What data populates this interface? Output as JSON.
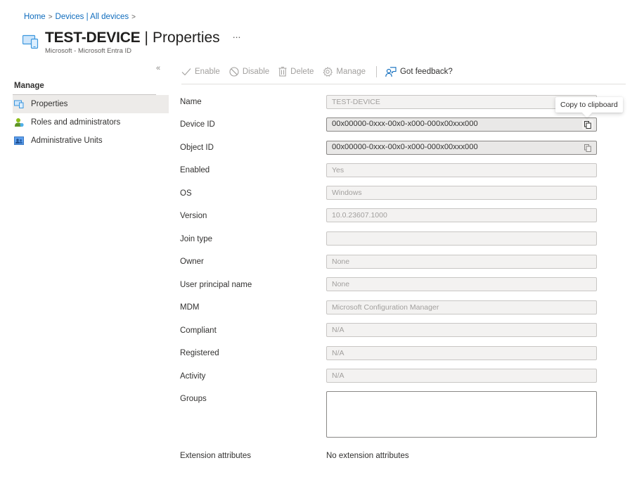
{
  "breadcrumb": {
    "items": [
      "Home",
      "Devices | All devices"
    ],
    "separator": ">"
  },
  "header": {
    "title": "TEST-DEVICE",
    "separator": "|",
    "page": "Properties",
    "more": "...",
    "subtitle": "Microsoft - Microsoft Entra ID",
    "icon": "device-icon"
  },
  "sidebar": {
    "collapse_glyph": "«",
    "section": "Manage",
    "items": [
      {
        "label": "Properties",
        "icon": "devices-icon",
        "active": true
      },
      {
        "label": "Roles and administrators",
        "icon": "roles-icon",
        "active": false
      },
      {
        "label": "Administrative Units",
        "icon": "admin-units-icon",
        "active": false
      }
    ]
  },
  "toolbar": {
    "enable": "Enable",
    "disable": "Disable",
    "delete": "Delete",
    "manage": "Manage",
    "feedback": "Got feedback?"
  },
  "tooltip": {
    "text": "Copy to clipboard"
  },
  "properties": {
    "name": {
      "label": "Name",
      "value": "TEST-DEVICE"
    },
    "device_id": {
      "label": "Device ID",
      "value": "00x00000-0xxx-00x0-x000-000x00xxx000"
    },
    "object_id": {
      "label": "Object ID",
      "value": "00x00000-0xxx-00x0-x000-000x00xxx000"
    },
    "enabled": {
      "label": "Enabled",
      "value": "Yes"
    },
    "os": {
      "label": "OS",
      "value": "Windows"
    },
    "version": {
      "label": "Version",
      "value": "10.0.23607.1000"
    },
    "join_type": {
      "label": "Join type",
      "value": ""
    },
    "owner": {
      "label": "Owner",
      "value": "None"
    },
    "upn": {
      "label": "User principal name",
      "value": "None"
    },
    "mdm": {
      "label": "MDM",
      "value": "Microsoft Configuration Manager"
    },
    "compliant": {
      "label": "Compliant",
      "value": "N/A"
    },
    "registered": {
      "label": "Registered",
      "value": "N/A"
    },
    "activity": {
      "label": "Activity",
      "value": "N/A"
    },
    "groups": {
      "label": "Groups",
      "value": ""
    },
    "extension_attributes": {
      "label": "Extension attributes",
      "value": "No extension attributes"
    }
  },
  "colors": {
    "accent": "#0f6cbd",
    "active_nav": "#edebe9",
    "disabled_text": "#a19f9d"
  }
}
